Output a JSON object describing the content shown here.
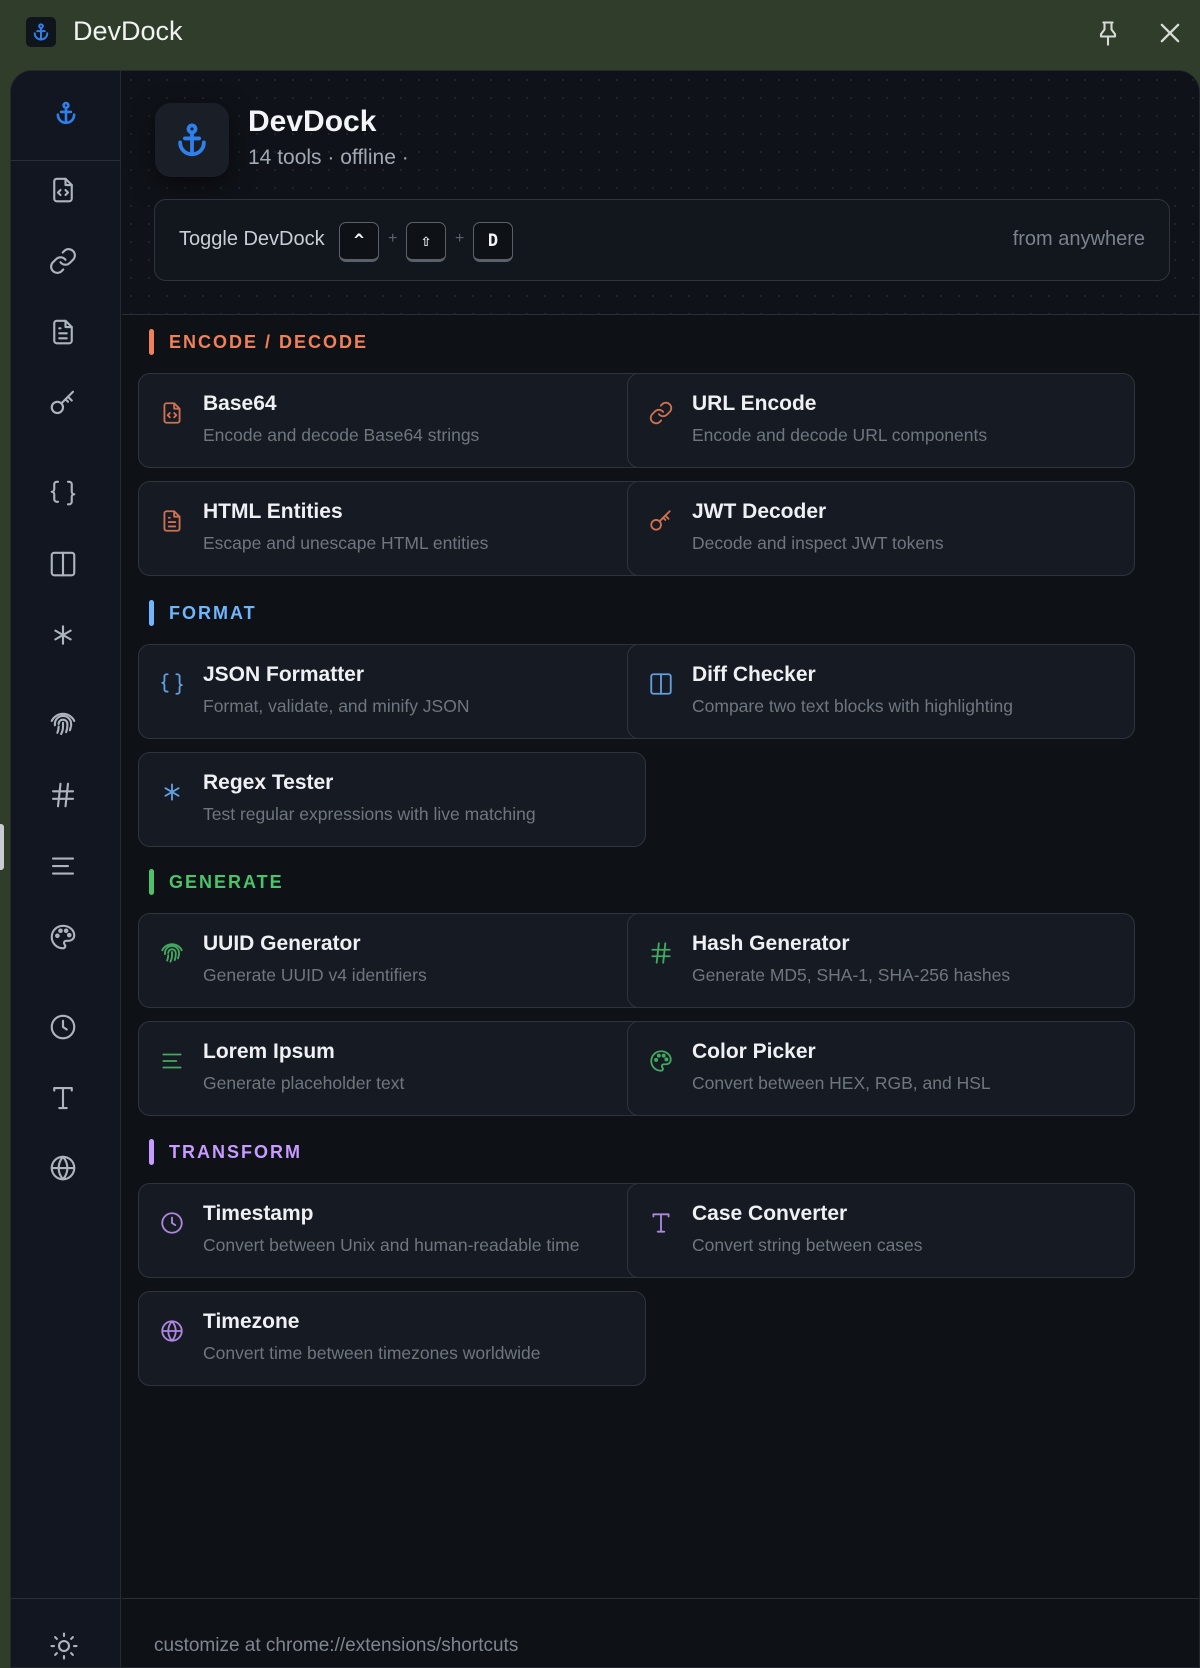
{
  "window": {
    "title": "DevDock",
    "colors": {
      "chrome_bg": "#2f3d2a",
      "panel_bg": "#0e1116",
      "anchor_blue": "#2f80ed"
    }
  },
  "header": {
    "title": "DevDock",
    "subtitle": "14 tools · offline ·",
    "shortcut": {
      "label": "Toggle DevDock",
      "keys": [
        "^",
        "⇧",
        "D"
      ],
      "plus": "+",
      "hint": "from anywhere"
    }
  },
  "sidebar": {
    "items": [
      {
        "icon": "file-code-icon"
      },
      {
        "icon": "link-icon"
      },
      {
        "icon": "file-text-icon"
      },
      {
        "icon": "key-icon"
      },
      {
        "icon": "braces-icon"
      },
      {
        "icon": "columns-icon"
      },
      {
        "icon": "asterisk-icon"
      },
      {
        "icon": "fingerprint-icon"
      },
      {
        "icon": "hash-icon"
      },
      {
        "icon": "align-left-icon"
      },
      {
        "icon": "palette-icon"
      },
      {
        "icon": "clock-icon"
      },
      {
        "icon": "type-icon"
      },
      {
        "icon": "globe-icon"
      }
    ],
    "settings_icon": "sun-icon"
  },
  "sections": [
    {
      "title": "ENCODE / DECODE",
      "color": "#f0805a",
      "tools": [
        {
          "title": "Base64",
          "desc": "Encode and decode Base64 strings",
          "icon": "file-code-icon"
        },
        {
          "title": "URL Encode",
          "desc": "Encode and decode URL components",
          "icon": "link-icon"
        },
        {
          "title": "HTML Entities",
          "desc": "Escape and unescape HTML entities",
          "icon": "file-text-icon"
        },
        {
          "title": "JWT Decoder",
          "desc": "Decode and inspect JWT tokens",
          "icon": "key-icon"
        }
      ]
    },
    {
      "title": "FORMAT",
      "color": "#6fb6ff",
      "tools": [
        {
          "title": "JSON Formatter",
          "desc": "Format, validate, and minify JSON",
          "icon": "braces-icon"
        },
        {
          "title": "Diff Checker",
          "desc": "Compare two text blocks with highlighting",
          "icon": "columns-icon"
        },
        {
          "title": "Regex Tester",
          "desc": "Test regular expressions with live matching",
          "icon": "asterisk-icon"
        }
      ]
    },
    {
      "title": "GENERATE",
      "color": "#4cc36b",
      "tools": [
        {
          "title": "UUID Generator",
          "desc": "Generate UUID v4 identifiers",
          "icon": "fingerprint-icon"
        },
        {
          "title": "Hash Generator",
          "desc": "Generate MD5, SHA-1, SHA-256 hashes",
          "icon": "hash-icon"
        },
        {
          "title": "Lorem Ipsum",
          "desc": "Generate placeholder text",
          "icon": "align-left-icon"
        },
        {
          "title": "Color Picker",
          "desc": "Convert between HEX, RGB, and HSL",
          "icon": "palette-icon"
        }
      ]
    },
    {
      "title": "TRANSFORM",
      "color": "#c79bff",
      "tools": [
        {
          "title": "Timestamp",
          "desc": "Convert between Unix and human-readable time",
          "icon": "clock-icon"
        },
        {
          "title": "Case Converter",
          "desc": "Convert string between cases",
          "icon": "type-icon"
        },
        {
          "title": "Timezone",
          "desc": "Convert time between timezones worldwide",
          "icon": "globe-icon"
        }
      ]
    }
  ],
  "footer": {
    "text": "customize at chrome://extensions/shortcuts"
  }
}
